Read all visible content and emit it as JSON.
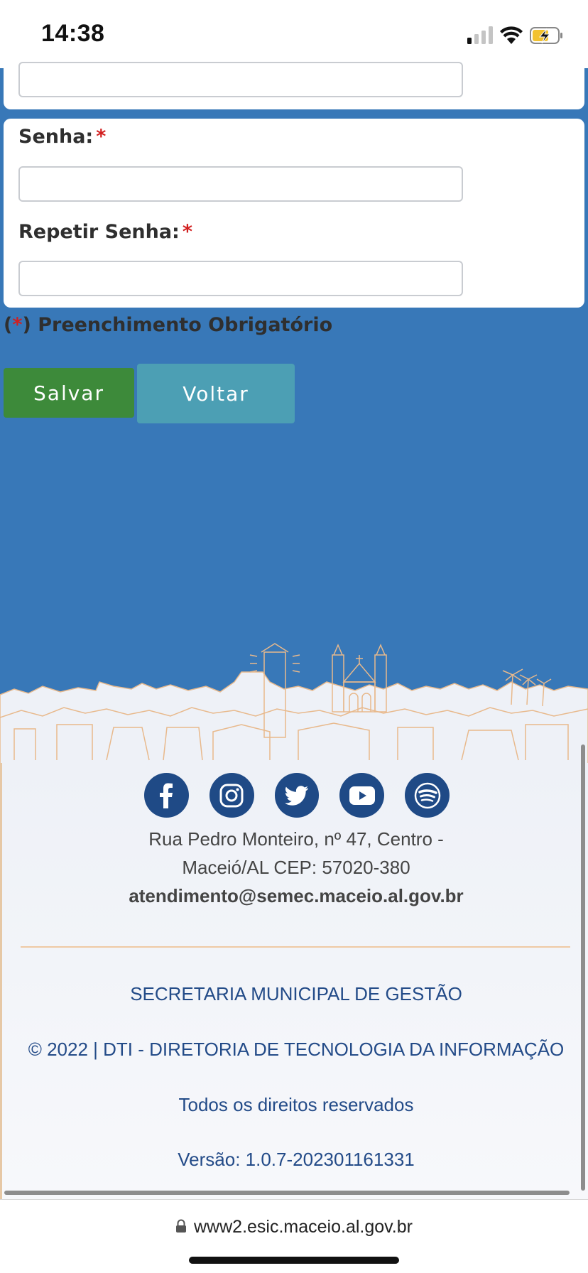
{
  "status_bar": {
    "time": "14:38"
  },
  "form": {
    "senha_label": "Senha:",
    "repetir_label": "Repetir Senha:",
    "required_mark": "*",
    "required_note_open": "(",
    "required_note_star": "*",
    "required_note_text": ") Preenchimento Obrigatório"
  },
  "buttons": {
    "save": "Salvar",
    "back": "Voltar"
  },
  "footer": {
    "social": [
      "facebook-icon",
      "instagram-icon",
      "twitter-icon",
      "youtube-icon",
      "spotify-icon"
    ],
    "address_line1": "Rua Pedro Monteiro, nº 47, Centro -",
    "address_line2": "Maceió/AL CEP: 57020-380",
    "email": "atendimento@semec.maceio.al.gov.br",
    "secretaria": "SECRETARIA MUNICIPAL DE GESTÃO",
    "copyright": "© 2022 | DTI - DIRETORIA DE TECNOLOGIA DA INFORMAÇÃO",
    "rights": "Todos os direitos reservados",
    "version": "Versão: 1.0.7-202301161331"
  },
  "browser": {
    "url": "www2.esic.maceio.al.gov.br"
  },
  "colors": {
    "page_bg": "#3878b8",
    "save_button": "#3d8a3a",
    "back_button": "#4c9fb4",
    "footer_text": "#234b88",
    "social_icon_bg": "#1f4a86",
    "required_star": "#d21f1f"
  }
}
